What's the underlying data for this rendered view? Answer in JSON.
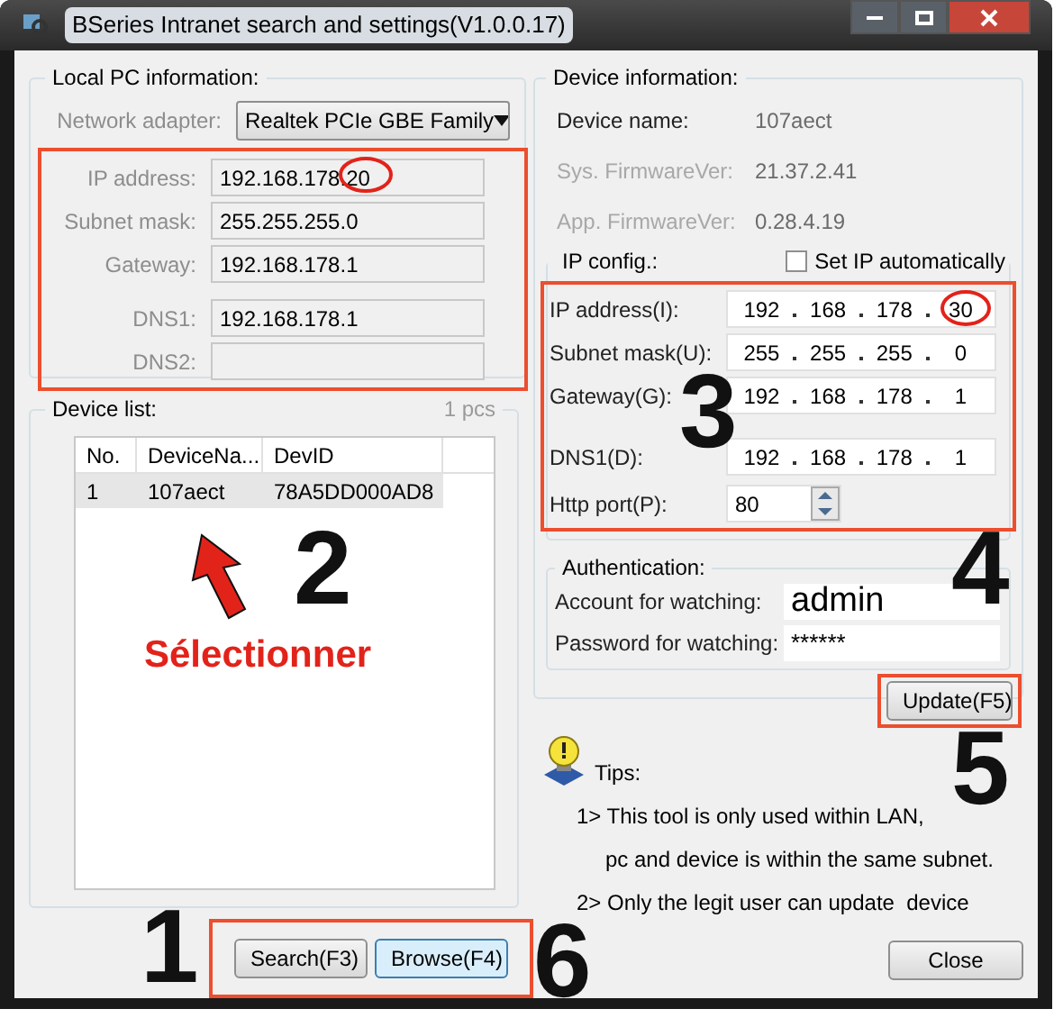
{
  "window": {
    "title": "BSeries Intranet search and settings(V1.0.0.17)"
  },
  "local_pc": {
    "title": "Local PC information:",
    "adapter": {
      "label": "Network adapter:",
      "value": "Realtek PCIe GBE Family"
    },
    "rows": [
      {
        "label": "IP address:",
        "value": "192.168.178.20"
      },
      {
        "label": "Subnet mask:",
        "value": "255.255.255.0"
      },
      {
        "label": "Gateway:",
        "value": "192.168.178.1"
      },
      {
        "label": "DNS1:",
        "value": "192.168.178.1"
      },
      {
        "label": "DNS2:"
      }
    ]
  },
  "device_list": {
    "title": "Device list:",
    "count": "1 pcs",
    "columns": [
      "No.",
      "DeviceNa...",
      "DevID"
    ],
    "rows": [
      {
        "cells": [
          "1",
          "107aect",
          "78A5DD000AD8"
        ],
        "selected": true
      }
    ]
  },
  "list_buttons": [
    {
      "label": "Search(F3)",
      "focused": false
    },
    {
      "label": "Browse(F4)",
      "focused": true
    }
  ],
  "device_info": {
    "title": "Device information:",
    "rows": [
      {
        "label": "Device name:",
        "value": "107aect",
        "disabled": false
      },
      {
        "label": "Sys. FirmwareVer:",
        "value": "21.37.2.41",
        "disabled": true
      },
      {
        "label": "App. FirmwareVer:",
        "value": "0.28.4.19",
        "disabled": true
      }
    ]
  },
  "ip_config": {
    "title": "IP config.:",
    "auto": {
      "label": "Set IP automatically",
      "checked": false
    },
    "fields": [
      {
        "label": "IP address(I):",
        "octets": [
          "192",
          "168",
          "178",
          "30"
        ]
      },
      {
        "label": "Subnet mask(U):",
        "octets": [
          "255",
          "255",
          "255",
          "0"
        ]
      },
      {
        "label": "Gateway(G):",
        "octets": [
          "192",
          "168",
          "178",
          "1"
        ]
      },
      {
        "label": "DNS1(D):",
        "octets": [
          "192",
          "168",
          "178",
          "1"
        ]
      }
    ],
    "http_port": {
      "label": "Http port(P):",
      "value": "80"
    }
  },
  "authentication": {
    "title": "Authentication:",
    "account": {
      "label": "Account for watching:",
      "value": "admin"
    },
    "password": {
      "label": "Password for watching:",
      "value": "******"
    }
  },
  "update_button": "Update(F5)",
  "tips": {
    "title": "Tips:",
    "lines": [
      "1> This tool is only used within LAN,",
      "pc and device is within the same subnet.",
      "2> Only the legit user can update  device"
    ]
  },
  "close_button": "Close",
  "annotations": [
    {
      "kind": "number",
      "text": "1"
    },
    {
      "kind": "number",
      "text": "2"
    },
    {
      "kind": "number",
      "text": "3"
    },
    {
      "kind": "number",
      "text": "4"
    },
    {
      "kind": "number",
      "text": "5"
    },
    {
      "kind": "number",
      "text": "6"
    },
    {
      "kind": "callout",
      "text": "Sélectionner"
    }
  ]
}
